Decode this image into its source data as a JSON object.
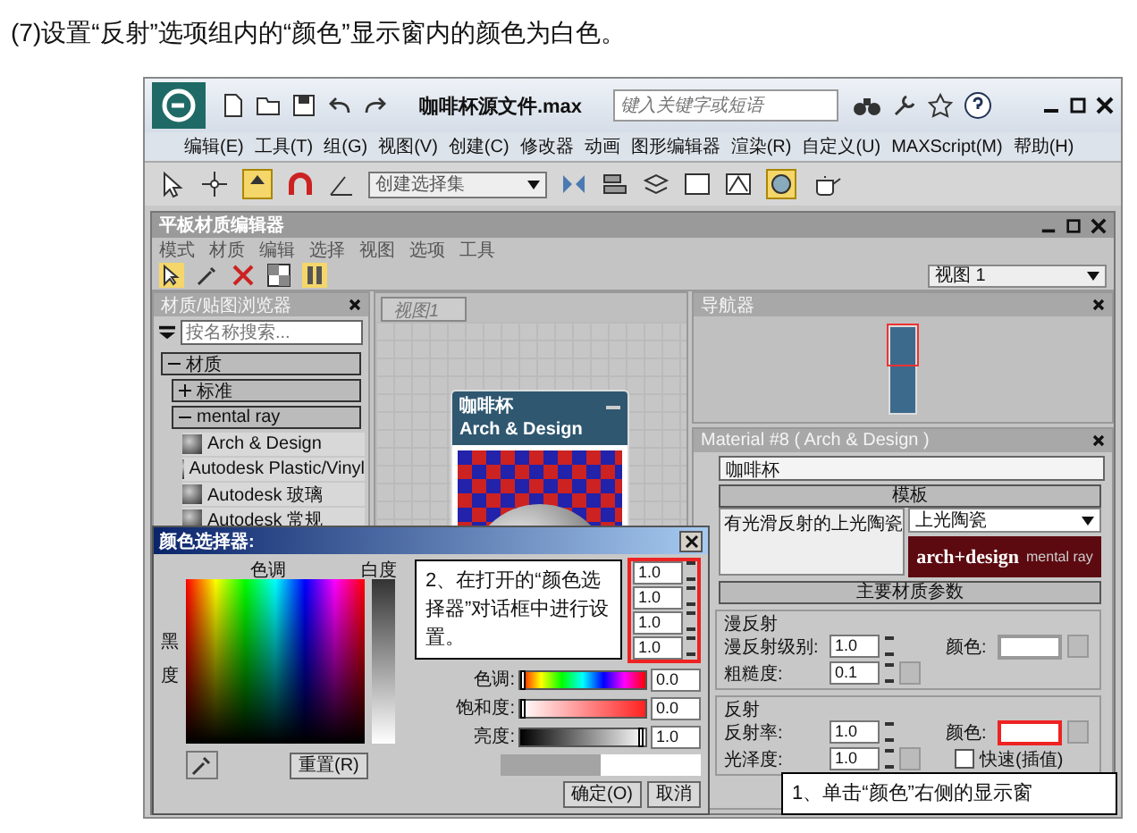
{
  "caption": "(7)设置“反射”选项组内的“颜色”显示窗内的颜色为白色。",
  "app": {
    "title": "咖啡杯源文件.max",
    "search_placeholder": "键入关键字或短语",
    "menu": [
      "编辑(E)",
      "工具(T)",
      "组(G)",
      "视图(V)",
      "创建(C)",
      "修改器",
      "动画",
      "图形编辑器",
      "渲染(R)",
      "自定义(U)",
      "MAXScript(M)",
      "帮助(H)"
    ],
    "selection_set": "创建选择集"
  },
  "editor": {
    "title": "平板材质编辑器",
    "menu": [
      "模式",
      "材质",
      "编辑",
      "选择",
      "视图",
      "选项",
      "工具"
    ],
    "view_dropdown": "视图 1",
    "browser": {
      "title": "材质/贴图浏览器",
      "search_placeholder": "按名称搜索...",
      "tree": [
        {
          "label": "材质",
          "expanded": true,
          "children": [
            {
              "label": "标准",
              "expanded": false
            },
            {
              "label": "mental ray",
              "expanded": true,
              "materials": [
                "Arch & Design",
                "Autodesk Plastic/Vinyl",
                "Autodesk 玻璃",
                "Autodesk 常规"
              ]
            }
          ]
        }
      ]
    },
    "view_tab": "视图1",
    "node": {
      "title": "咖啡杯",
      "subtitle": "Arch & Design"
    },
    "navigator": {
      "title": "导航器"
    },
    "material": {
      "title": "Material #8  ( Arch & Design )",
      "name": "咖啡杯",
      "template_rollout": "模板",
      "template_item": "有光滑反射的上光陶瓷",
      "template_dropdown": "上光陶瓷",
      "logo": "arch+design",
      "logo_sub": "mental ray",
      "main_rollout": "主要材质参数",
      "groups": [
        {
          "title": "漫反射",
          "rows": [
            {
              "label": "漫反射级别:",
              "value": "1.0",
              "color_label": "颜色:",
              "color": "#ffffff",
              "highlighted": false
            },
            {
              "label": "粗糙度:",
              "value": "0.1"
            }
          ]
        },
        {
          "title": "反射",
          "rows": [
            {
              "label": "反射率:",
              "value": "1.0",
              "color_label": "颜色:",
              "color": "#ffffff",
              "highlighted": true
            },
            {
              "label": "光泽度:",
              "value": "1.0",
              "check_label": "快速(插值)",
              "checked": false
            }
          ]
        }
      ]
    }
  },
  "color_picker": {
    "title": "颜色选择器:",
    "hue_label": "色调",
    "whiteness_label": "白度",
    "blackness_label": "黑度",
    "channels": [
      "1.0",
      "1.0",
      "1.0",
      "1.0"
    ],
    "sliders": [
      {
        "kind": "hue",
        "label": "色调:",
        "value": "0.0",
        "level": 0
      },
      {
        "kind": "saturation",
        "label": "饱和度:",
        "value": "0.0",
        "level": 0
      },
      {
        "kind": "value",
        "label": "亮度:",
        "value": "1.0",
        "level": 1
      }
    ],
    "preview": [
      {
        "color": "#a4a4a4"
      },
      {
        "color": "#ffffff"
      }
    ],
    "reset": "重置(R)",
    "ok": "确定(O)",
    "cancel": "取消"
  },
  "callouts": [
    "2、在打开的“颜色选择器”对话框中进行设置。",
    "1、单击“颜色”右侧的显示窗"
  ]
}
